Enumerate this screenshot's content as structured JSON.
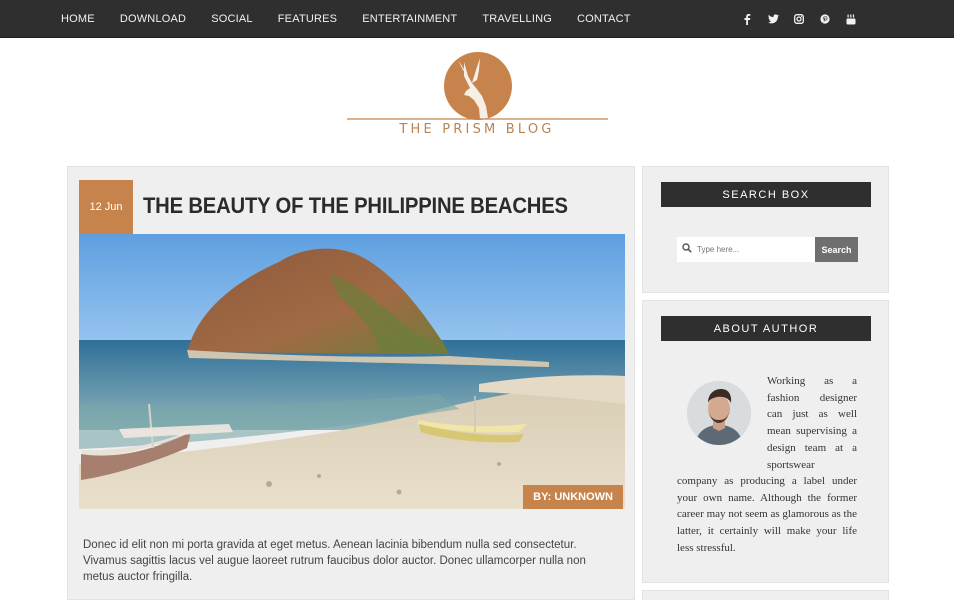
{
  "nav": {
    "items": [
      "HOME",
      "DOWNLOAD",
      "SOCIAL",
      "FEATURES",
      "ENTERTAINMENT",
      "TRAVELLING",
      "CONTACT"
    ],
    "social_icons": [
      "facebook-icon",
      "twitter-icon",
      "instagram-icon",
      "pinterest-icon",
      "youtube-icon"
    ]
  },
  "logo": {
    "text": "THE PRISM BLOG",
    "color": "#c6844c"
  },
  "post": {
    "date": "12 Jun",
    "title": "THE BEAUTY OF THE PHILIPPINE BEACHES",
    "author_tag": "BY: UNKNOWN",
    "excerpt": "Donec id elit non mi porta gravida at eget metus. Aenean lacinia bibendum nulla sed consectetur. Vivamus sagittis lacus vel augue laoreet rutrum faucibus dolor auctor. Donec ullamcorper nulla non metus auctor fringilla."
  },
  "search_widget": {
    "title": "SEARCH BOX",
    "placeholder": "Type here...",
    "button_label": "Search"
  },
  "author_widget": {
    "title": "ABOUT AUTHOR",
    "bio_top": "Working as a fashion designer can just as well mean supervising a design team at a sportswear",
    "bio_bottom": "company as producing a label under your own name. Although the former career may not seem as glamorous as the latter, it certainly will make your life less stressful."
  },
  "colors": {
    "accent": "#c6844c",
    "nav_bg": "#2f2f2f",
    "panel_bg": "#efefef"
  }
}
